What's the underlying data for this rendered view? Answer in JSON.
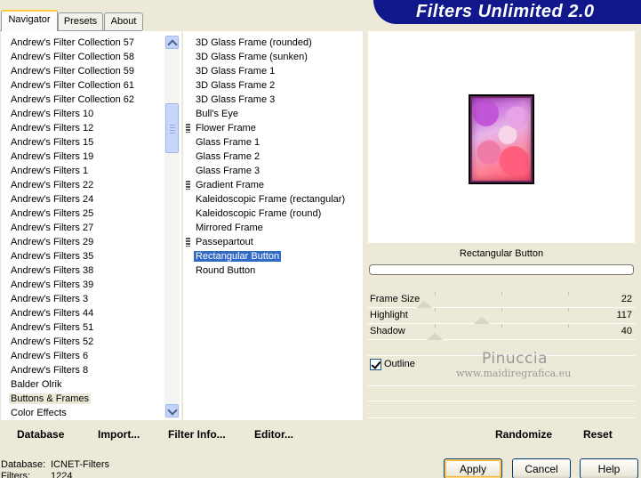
{
  "tabs": [
    {
      "label": "Navigator",
      "active": true
    },
    {
      "label": "Presets",
      "active": false
    },
    {
      "label": "About",
      "active": false
    }
  ],
  "banner": {
    "title": "Filters Unlimited 2.0"
  },
  "categories": {
    "items": [
      "Andrew's Filter Collection 57",
      "Andrew's Filter Collection 58",
      "Andrew's Filter Collection 59",
      "Andrew's Filter Collection 61",
      "Andrew's Filter Collection 62",
      "Andrew's Filters 10",
      "Andrew's Filters 12",
      "Andrew's Filters 15",
      "Andrew's Filters 19",
      "Andrew's Filters 1",
      "Andrew's Filters 22",
      "Andrew's Filters 24",
      "Andrew's Filters 25",
      "Andrew's Filters 27",
      "Andrew's Filters 29",
      "Andrew's Filters 35",
      "Andrew's Filters 38",
      "Andrew's Filters 39",
      "Andrew's Filters 3",
      "Andrew's Filters 44",
      "Andrew's Filters 51",
      "Andrew's Filters 52",
      "Andrew's Filters 6",
      "Andrew's Filters 8",
      "Balder Olrik",
      "Buttons & Frames",
      "Color Effects"
    ],
    "selected": "Buttons & Frames"
  },
  "filters": {
    "items": [
      {
        "label": "3D Glass Frame (rounded)",
        "group": false
      },
      {
        "label": "3D Glass Frame (sunken)",
        "group": false
      },
      {
        "label": "3D Glass Frame 1",
        "group": false
      },
      {
        "label": "3D Glass Frame 2",
        "group": false
      },
      {
        "label": "3D Glass Frame 3",
        "group": false
      },
      {
        "label": "Bull's Eye",
        "group": false
      },
      {
        "label": "Flower Frame",
        "group": true
      },
      {
        "label": "Glass Frame 1",
        "group": false
      },
      {
        "label": "Glass Frame 2",
        "group": false
      },
      {
        "label": "Glass Frame 3",
        "group": false
      },
      {
        "label": "Gradient Frame",
        "group": true
      },
      {
        "label": "Kaleidoscopic Frame (rectangular)",
        "group": false
      },
      {
        "label": "Kaleidoscopic Frame (round)",
        "group": false
      },
      {
        "label": "Mirrored Frame",
        "group": false
      },
      {
        "label": "Passepartout",
        "group": true
      },
      {
        "label": "Rectangular Button",
        "group": false
      },
      {
        "label": "Round Button",
        "group": false
      }
    ],
    "selected": "Rectangular Button"
  },
  "preview": {
    "filter_name": "Rectangular Button",
    "progress_fraction": 0
  },
  "params": [
    {
      "label": "Frame Size",
      "value": "22",
      "level": 0.086
    },
    {
      "label": "Highlight",
      "value": "117",
      "level": 0.459
    },
    {
      "label": "Shadow",
      "value": "40",
      "level": 0.157
    }
  ],
  "outline": {
    "label": "Outline",
    "checked": true
  },
  "watermark": {
    "line1": "Pinuccia",
    "line2": "www.maidiregrafica.eu"
  },
  "toolbar": {
    "database": "Database",
    "import": "Import...",
    "filter_info": "Filter Info...",
    "editor": "Editor...",
    "randomize": "Randomize",
    "reset": "Reset"
  },
  "status": {
    "database_label": "Database:",
    "database_value": "ICNET-Filters",
    "filters_label": "Filters:",
    "filters_value": "1224"
  },
  "buttons": {
    "apply": "Apply",
    "cancel": "Cancel",
    "help": "Help"
  }
}
